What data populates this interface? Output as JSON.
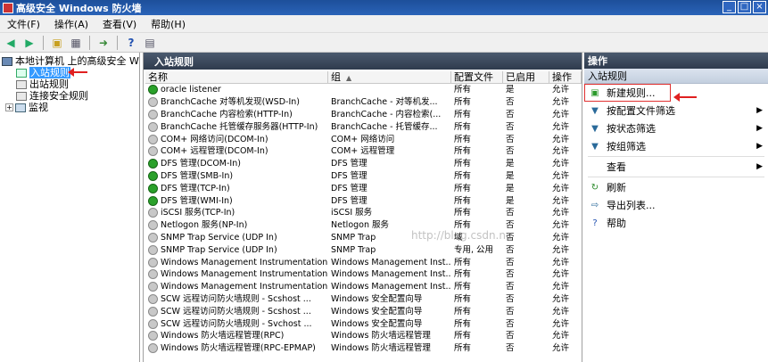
{
  "window": {
    "title": "高级安全 Windows 防火墙",
    "buttons": [
      "_",
      "□",
      "×"
    ]
  },
  "menu": [
    "文件(F)",
    "操作(A)",
    "查看(V)",
    "帮助(H)"
  ],
  "tree": {
    "root": "本地计算机 上的高级安全 Windows",
    "items": [
      "入站规则",
      "出站规则",
      "连接安全规则",
      "监视"
    ]
  },
  "center": {
    "title": "入站规则",
    "columns": [
      "名称",
      "组",
      "配置文件",
      "已启用",
      "操作"
    ],
    "watermark": "http://blog.csdn.ne",
    "rows": [
      {
        "name": "oracle listener",
        "group": "",
        "profile": "所有",
        "enabled": "是",
        "action": "允许",
        "on": true
      },
      {
        "name": "BranchCache 对等机发现(WSD-In)",
        "group": "BranchCache - 对等机发...",
        "profile": "所有",
        "enabled": "否",
        "action": "允许",
        "on": false
      },
      {
        "name": "BranchCache 内容检索(HTTP-In)",
        "group": "BranchCache - 内容检索(...",
        "profile": "所有",
        "enabled": "否",
        "action": "允许",
        "on": false
      },
      {
        "name": "BranchCache 托管缓存服务器(HTTP-In)",
        "group": "BranchCache - 托管缓存...",
        "profile": "所有",
        "enabled": "否",
        "action": "允许",
        "on": false
      },
      {
        "name": "COM+ 网络访问(DCOM-In)",
        "group": "COM+ 网络访问",
        "profile": "所有",
        "enabled": "否",
        "action": "允许",
        "on": false
      },
      {
        "name": "COM+ 远程管理(DCOM-In)",
        "group": "COM+ 远程管理",
        "profile": "所有",
        "enabled": "否",
        "action": "允许",
        "on": false
      },
      {
        "name": "DFS 管理(DCOM-In)",
        "group": "DFS 管理",
        "profile": "所有",
        "enabled": "是",
        "action": "允许",
        "on": true
      },
      {
        "name": "DFS 管理(SMB-In)",
        "group": "DFS 管理",
        "profile": "所有",
        "enabled": "是",
        "action": "允许",
        "on": true
      },
      {
        "name": "DFS 管理(TCP-In)",
        "group": "DFS 管理",
        "profile": "所有",
        "enabled": "是",
        "action": "允许",
        "on": true
      },
      {
        "name": "DFS 管理(WMI-In)",
        "group": "DFS 管理",
        "profile": "所有",
        "enabled": "是",
        "action": "允许",
        "on": true
      },
      {
        "name": "iSCSI 服务(TCP-In)",
        "group": "iSCSI 服务",
        "profile": "所有",
        "enabled": "否",
        "action": "允许",
        "on": false
      },
      {
        "name": "Netlogon 服务(NP-In)",
        "group": "Netlogon 服务",
        "profile": "所有",
        "enabled": "否",
        "action": "允许",
        "on": false
      },
      {
        "name": "SNMP Trap Service (UDP In)",
        "group": "SNMP Trap",
        "profile": "域",
        "enabled": "否",
        "action": "允许",
        "on": false
      },
      {
        "name": "SNMP Trap Service (UDP In)",
        "group": "SNMP Trap",
        "profile": "专用, 公用",
        "enabled": "否",
        "action": "允许",
        "on": false
      },
      {
        "name": "Windows Management Instrumentation...",
        "group": "Windows Management Inst...",
        "profile": "所有",
        "enabled": "否",
        "action": "允许",
        "on": false
      },
      {
        "name": "Windows Management Instrumentation...",
        "group": "Windows Management Inst...",
        "profile": "所有",
        "enabled": "否",
        "action": "允许",
        "on": false
      },
      {
        "name": "Windows Management Instrumentation...",
        "group": "Windows Management Inst...",
        "profile": "所有",
        "enabled": "否",
        "action": "允许",
        "on": false
      },
      {
        "name": "SCW 远程访问防火墙规则 - Scshost ...",
        "group": "Windows 安全配置向导",
        "profile": "所有",
        "enabled": "否",
        "action": "允许",
        "on": false
      },
      {
        "name": "SCW 远程访问防火墙规则 - Scshost ...",
        "group": "Windows 安全配置向导",
        "profile": "所有",
        "enabled": "否",
        "action": "允许",
        "on": false
      },
      {
        "name": "SCW 远程访问防火墙规则 - Svchost ...",
        "group": "Windows 安全配置向导",
        "profile": "所有",
        "enabled": "否",
        "action": "允许",
        "on": false
      },
      {
        "name": "Windows 防火墙远程管理(RPC)",
        "group": "Windows 防火墙远程管理",
        "profile": "所有",
        "enabled": "否",
        "action": "允许",
        "on": false
      },
      {
        "name": "Windows 防火墙远程管理(RPC-EPMAP)",
        "group": "Windows 防火墙远程管理",
        "profile": "所有",
        "enabled": "否",
        "action": "允许",
        "on": false
      }
    ]
  },
  "actions": {
    "title": "操作",
    "section": "入站规则",
    "items": [
      {
        "label": "新建规则...",
        "icon": "new-rule-icon",
        "submenu": false
      },
      {
        "label": "按配置文件筛选",
        "icon": "filter-icon",
        "submenu": true
      },
      {
        "label": "按状态筛选",
        "icon": "filter-icon",
        "submenu": true
      },
      {
        "label": "按组筛选",
        "icon": "filter-icon",
        "submenu": true
      },
      {
        "label": "查看",
        "icon": "",
        "submenu": true
      },
      {
        "label": "刷新",
        "icon": "refresh-icon",
        "submenu": false
      },
      {
        "label": "导出列表...",
        "icon": "export-icon",
        "submenu": false
      },
      {
        "label": "帮助",
        "icon": "help-icon",
        "submenu": false
      }
    ]
  },
  "colors": {
    "highlight": "#3399ff",
    "annotation": "#e02020",
    "header": "#2f3b4d"
  }
}
